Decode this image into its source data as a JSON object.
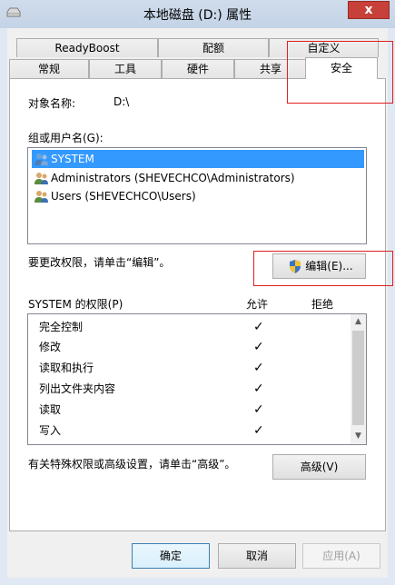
{
  "window": {
    "title": "本地磁盘 (D:) 属性",
    "close_label": "x"
  },
  "tabs": {
    "row1": [
      "ReadyBoost",
      "配额",
      "自定义"
    ],
    "row2": [
      "常规",
      "工具",
      "硬件",
      "共享",
      "安全"
    ],
    "active": "安全"
  },
  "object": {
    "label": "对象名称:",
    "value": "D:\\"
  },
  "groups": {
    "label": "组或用户名(G):",
    "items": [
      {
        "name": "SYSTEM",
        "selected": true
      },
      {
        "name": "Administrators (SHEVECHCO\\Administrators)",
        "selected": false
      },
      {
        "name": "Users (SHEVECHCO\\Users)",
        "selected": false
      }
    ]
  },
  "edit": {
    "hint": "要更改权限，请单击“编辑”。",
    "button": "编辑(E)..."
  },
  "permissions": {
    "title": "SYSTEM 的权限(P)",
    "allow_header": "允许",
    "deny_header": "拒绝",
    "rows": [
      {
        "name": "完全控制",
        "allow": "✓"
      },
      {
        "name": "修改",
        "allow": "✓"
      },
      {
        "name": "读取和执行",
        "allow": "✓"
      },
      {
        "name": "列出文件夹内容",
        "allow": "✓"
      },
      {
        "name": "读取",
        "allow": "✓"
      },
      {
        "name": "写入",
        "allow": "✓"
      }
    ]
  },
  "advanced": {
    "hint": "有关特殊权限或高级设置，请单击“高级”。",
    "button": "高级(V)"
  },
  "footer": {
    "ok": "确定",
    "cancel": "取消",
    "apply": "应用(A)"
  },
  "colors": {
    "highlight": "#3399ff",
    "annotation": "#e02020",
    "close": "#c7403a"
  }
}
